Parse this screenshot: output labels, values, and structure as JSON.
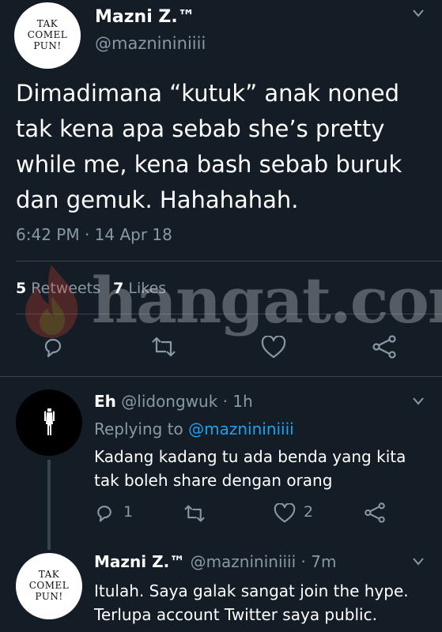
{
  "main_tweet": {
    "avatar_text": [
      "TAK",
      "COMEL",
      "PUN!"
    ],
    "name": "Mazni Z.™",
    "handle": "@maznininiiii",
    "text_lines": [
      "Dimadimana “kutuk” anak noned",
      "tak kena apa sebab she’s pretty",
      "while me, kena bash sebab buruk",
      "dan gemuk. Hahahahah."
    ],
    "timestamp": "6:42 PM · 14 Apr 18",
    "retweets_count": "5",
    "retweets_label": "Retweets",
    "likes_count": "7",
    "likes_label": "Likes"
  },
  "reply1": {
    "name": "Eh",
    "handle_time": "@lidongwuk · 1h",
    "replying_label": "Replying to",
    "replying_handle": "@maznininiiii",
    "text_lines": [
      "Kadang kadang tu ada benda yang kita",
      "tak boleh share dengan orang"
    ],
    "reply_count": "1",
    "like_count": "2"
  },
  "reply2": {
    "avatar_text": [
      "TAK",
      "COMEL",
      "PUN!"
    ],
    "name": "Mazni Z.™",
    "handle_time": "@maznininiiii · 7m",
    "text_lines": [
      "Itulah. Saya galak sangat join the hype.",
      "Terlupa account Twitter saya public."
    ]
  },
  "watermark": {
    "text": "hangat.com"
  },
  "colors": {
    "background": "#141d26",
    "muted": "#8899a6",
    "link": "#1da1f2",
    "divider": "#38444d"
  }
}
